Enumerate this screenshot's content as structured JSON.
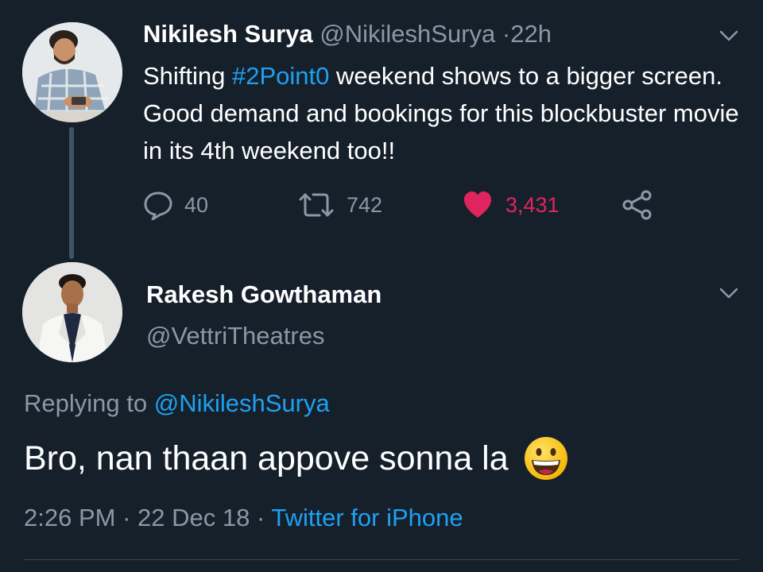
{
  "tweet1": {
    "author_name": "Nikilesh Surya",
    "author_handle": "@NikileshSurya",
    "separator": "·",
    "time_ago": "22h",
    "text_before": "Shifting ",
    "hashtag": "#2Point0",
    "text_after": " weekend shows to a bigger screen. Good demand and bookings for this blockbuster movie in its 4th weekend too!!",
    "actions": {
      "reply_count": "40",
      "retweet_count": "742",
      "like_count": "3,431"
    }
  },
  "tweet2": {
    "author_name": "Rakesh Gowthaman",
    "author_handle": "@VettriTheatres",
    "replying_prefix": "Replying to",
    "replying_handle": "@NikileshSurya",
    "text": "Bro, nan thaan appove sonna la",
    "emoji": "grinning-face-emoji",
    "time": "2:26 PM",
    "separator": "·",
    "date": "22 Dec 18",
    "source": "Twitter for iPhone"
  },
  "colors": {
    "background": "#16202b",
    "muted": "#8899a6",
    "link": "#1da1f2",
    "like": "#e0245e"
  },
  "icons": [
    "reply-icon",
    "retweet-icon",
    "heart-icon",
    "share-icon",
    "chevron-down-icon"
  ]
}
